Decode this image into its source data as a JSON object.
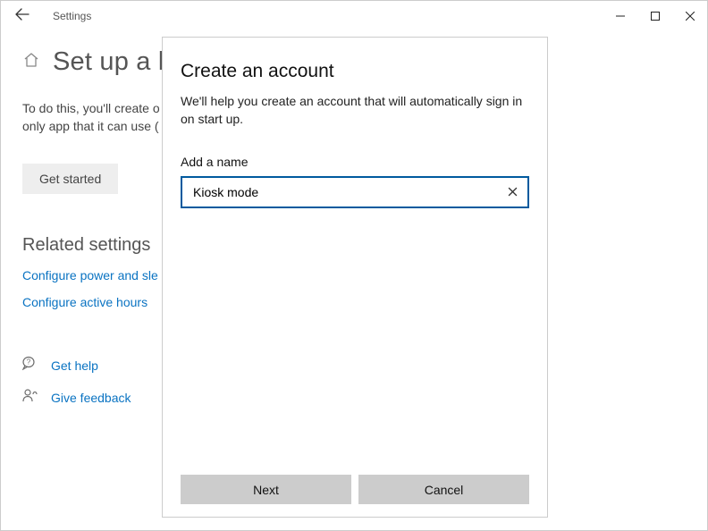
{
  "titlebar": {
    "app_name": "Settings"
  },
  "page": {
    "title": "Set up a k",
    "desc_line1": "To do this, you'll create o",
    "desc_line2": "only app that it can use (",
    "get_started": "Get started",
    "related_heading": "Related settings",
    "link_power": "Configure power and sle",
    "link_hours": "Configure active hours",
    "help_label": "Get help",
    "feedback_label": "Give feedback"
  },
  "modal": {
    "title": "Create an account",
    "subtitle": "We'll help you create an account that will automatically sign in on start up.",
    "field_label": "Add a name",
    "name_value": "Kiosk mode",
    "next": "Next",
    "cancel": "Cancel"
  }
}
